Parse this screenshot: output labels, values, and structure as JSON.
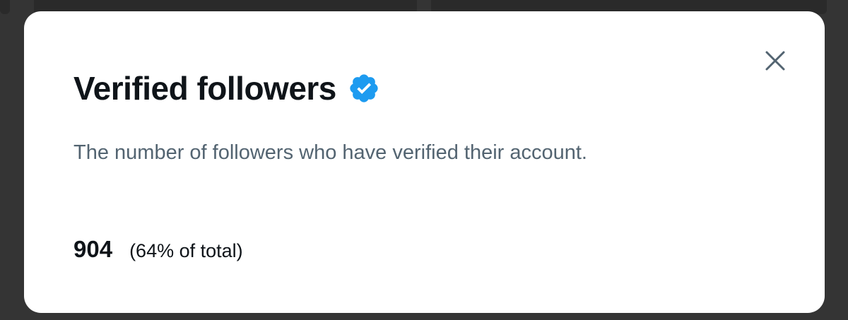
{
  "modal": {
    "title": "Verified followers",
    "badge_icon": "verified-badge-icon",
    "badge_color": "#1d9bf0",
    "close_icon": "close-icon",
    "description": "The number of followers who have verified their account.",
    "stat_value": "904",
    "stat_percent": "(64% of total)"
  },
  "colors": {
    "title": "#0f1419",
    "description": "#536471",
    "backdrop": "#343434"
  }
}
